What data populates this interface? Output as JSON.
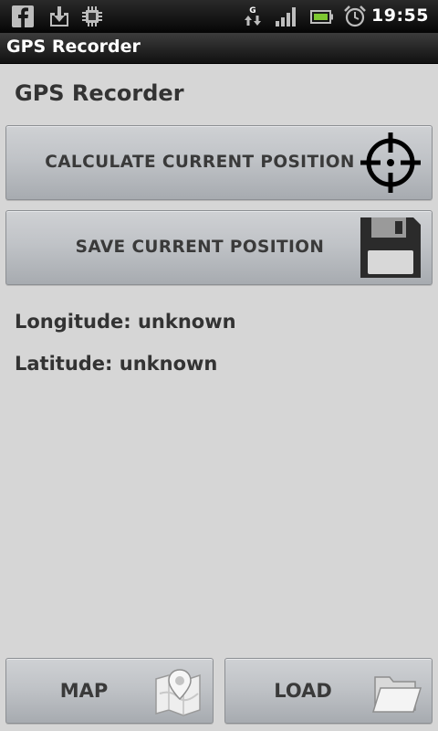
{
  "status_bar": {
    "time": "19:55",
    "network_letter": "G",
    "icons": [
      "facebook-icon",
      "download-icon",
      "chip-icon",
      "data-transfer-icon",
      "signal-icon",
      "battery-icon",
      "alarm-icon"
    ]
  },
  "app": {
    "title": "GPS Recorder"
  },
  "main": {
    "heading": "GPS Recorder",
    "calculate_button": {
      "label": "CALCULATE CURRENT POSITION",
      "icon": "crosshair-icon"
    },
    "save_button": {
      "label": "SAVE CURRENT POSITION",
      "icon": "floppy-disk-icon"
    },
    "longitude": "Longitude: unknown",
    "latitude": "Latitude: unknown"
  },
  "bottom_bar": {
    "map_button": {
      "label": "MAP",
      "icon": "map-pin-icon"
    },
    "load_button": {
      "label": "LOAD",
      "icon": "folder-icon"
    }
  },
  "colors": {
    "background": "#d6d6d6",
    "text": "#333333",
    "button_gradient_top": "#cfd1d4",
    "button_gradient_bottom": "#a7abb0",
    "status_bar": "#000000"
  }
}
